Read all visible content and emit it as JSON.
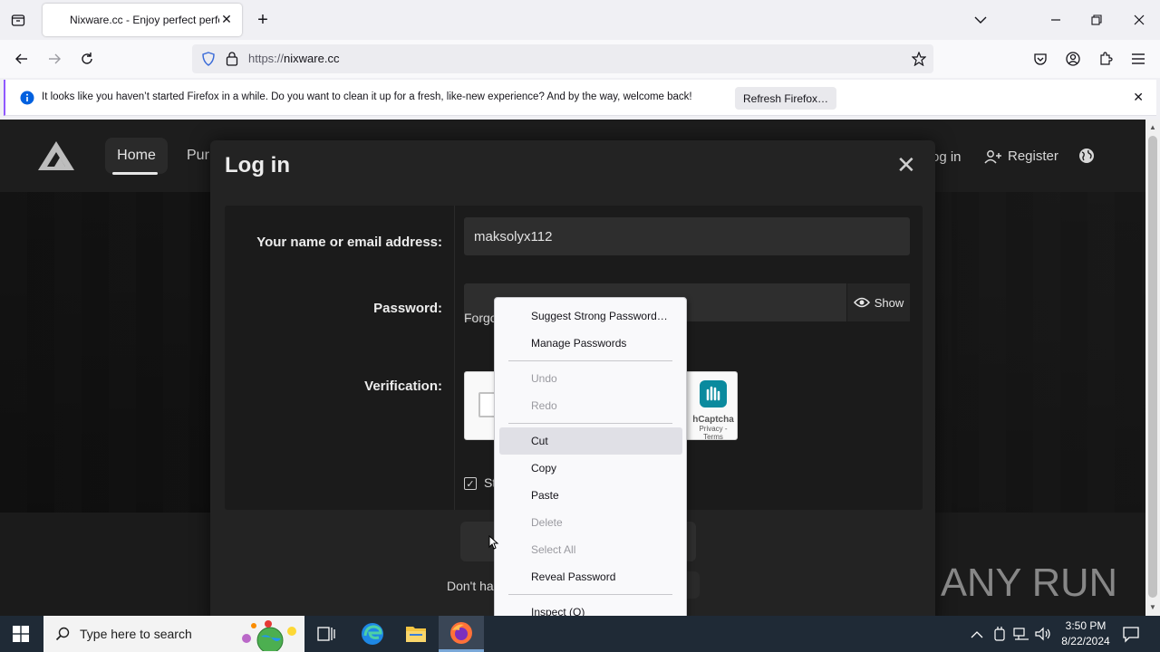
{
  "browser": {
    "tab_title": "Nixware.cc - Enjoy perfect perfo",
    "url_protocol": "https://",
    "url_domain": "nixware.cc",
    "notification_text": "It looks like you haven’t started Firefox in a while. Do you want to clean it up for a fresh, like-new experience? And by the way, welcome back!",
    "notification_button": "Refresh Firefox…"
  },
  "site": {
    "nav_home": "Home",
    "nav_purchase_partial": "Pur",
    "nav_login_partial": "og in",
    "nav_register": "Register"
  },
  "modal": {
    "title": "Log in",
    "username_label": "Your name or email address:",
    "username_value": "maksolyx112",
    "password_label": "Password:",
    "show_label": "Show",
    "forgot_partial": "Forgo",
    "verification_label": "Verification:",
    "captcha_name": "hCaptcha",
    "captcha_terms": "Privacy - Terms",
    "stay_partial": "St",
    "dont_have_partial": "Don't ha"
  },
  "context_menu": {
    "items": [
      {
        "label": "Suggest Strong Password…",
        "disabled": false
      },
      {
        "label": "Manage Passwords",
        "disabled": false
      },
      {
        "label": "Undo",
        "disabled": true
      },
      {
        "label": "Redo",
        "disabled": true
      },
      {
        "label": "Cut",
        "disabled": false
      },
      {
        "label": "Copy",
        "disabled": false
      },
      {
        "label": "Paste",
        "disabled": false
      },
      {
        "label": "Delete",
        "disabled": true
      },
      {
        "label": "Select All",
        "disabled": true
      },
      {
        "label": "Reveal Password",
        "disabled": false
      },
      {
        "label": "Inspect (Q)",
        "disabled": false
      }
    ]
  },
  "watermark": "ANY RUN",
  "taskbar": {
    "search_placeholder": "Type here to search",
    "time": "3:50 PM",
    "date": "8/22/2024"
  },
  "colors": {
    "accent": "#9059ff",
    "modal_bg": "#232323",
    "page_bg": "#161616"
  }
}
